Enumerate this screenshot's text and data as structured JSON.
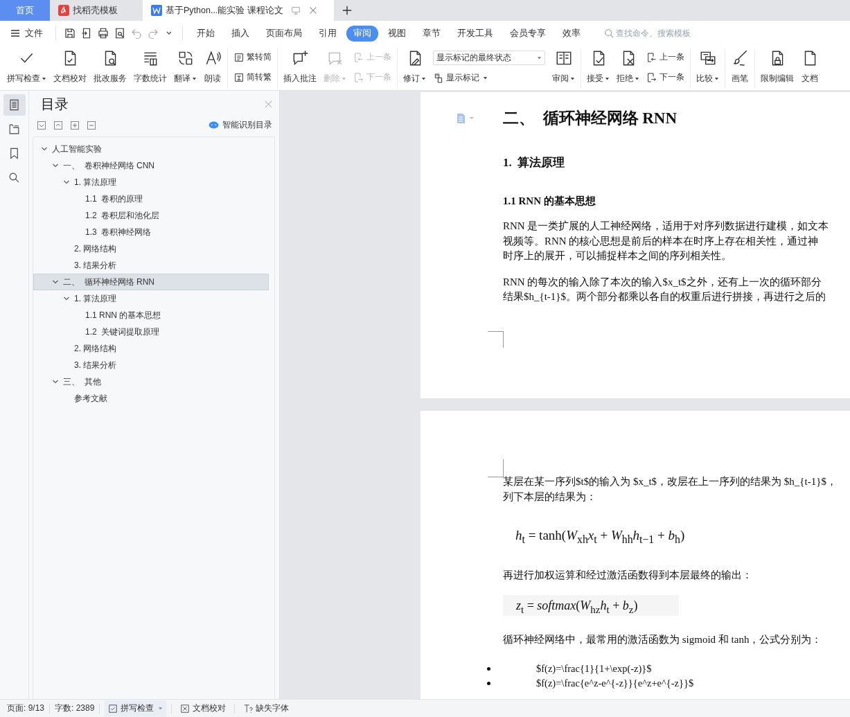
{
  "tabs": [
    {
      "kind": "home",
      "label": "首页",
      "selected": false
    },
    {
      "kind": "template",
      "label": "找稻壳模板",
      "selected": false
    },
    {
      "kind": "doc",
      "label": "基于Python...能实验 课程论文",
      "selected": true
    }
  ],
  "menu": {
    "file": "文件",
    "tabs": [
      {
        "label": "开始",
        "selected": false
      },
      {
        "label": "插入",
        "selected": false
      },
      {
        "label": "页面布局",
        "selected": false
      },
      {
        "label": "引用",
        "selected": false
      },
      {
        "label": "审阅",
        "selected": true
      },
      {
        "label": "视图",
        "selected": false
      },
      {
        "label": "章节",
        "selected": false
      },
      {
        "label": "开发工具",
        "selected": false
      },
      {
        "label": "会员专享",
        "selected": false
      },
      {
        "label": "效率",
        "selected": false
      }
    ],
    "search": {
      "placeholder": "查找命令、搜索模板"
    }
  },
  "ribbon": [
    {
      "items": [
        {
          "kind": "large",
          "label": "拼写检查",
          "dropdown": true,
          "disabled": false
        },
        {
          "kind": "large",
          "label": "文档校对",
          "dropdown": false,
          "disabled": false
        },
        {
          "kind": "large",
          "label": "批改服务",
          "dropdown": false,
          "disabled": false
        },
        {
          "kind": "large",
          "label": "字数统计",
          "dropdown": false,
          "disabled": false
        },
        {
          "kind": "large",
          "label": "翻译",
          "dropdown": true,
          "disabled": false
        },
        {
          "kind": "large",
          "label": "朗读",
          "dropdown": false,
          "disabled": false
        }
      ]
    },
    {
      "items": [
        {
          "kind": "stack",
          "items": [
            {
              "kind": "small",
              "label": "繁转简",
              "dropdown": false,
              "disabled": false
            },
            {
              "kind": "small",
              "label": "简转繁",
              "dropdown": false,
              "disabled": false
            }
          ]
        }
      ]
    },
    {
      "items": [
        {
          "kind": "large",
          "label": "插入批注",
          "dropdown": false,
          "disabled": false
        },
        {
          "kind": "large",
          "label": "删除",
          "dropdown": true,
          "disabled": true
        },
        {
          "kind": "stack",
          "items": [
            {
              "kind": "small",
              "label": "上一条",
              "dropdown": false,
              "disabled": true
            },
            {
              "kind": "small",
              "label": "下一条",
              "dropdown": false,
              "disabled": true
            }
          ]
        }
      ]
    },
    {
      "items": [
        {
          "kind": "large",
          "label": "修订",
          "dropdown": true,
          "disabled": false
        },
        {
          "kind": "stack",
          "items": [
            {
              "kind": "select",
              "value": "显示标记的最终状态"
            },
            {
              "kind": "small",
              "label": "显示标记",
              "dropdown": true,
              "disabled": false
            }
          ]
        },
        {
          "kind": "large",
          "label": "审阅",
          "dropdown": true,
          "disabled": false
        }
      ]
    },
    {
      "items": [
        {
          "kind": "large",
          "label": "接受",
          "dropdown": true,
          "disabled": false
        },
        {
          "kind": "large",
          "label": "拒绝",
          "dropdown": true,
          "disabled": false
        },
        {
          "kind": "stack",
          "items": [
            {
              "kind": "small",
              "label": "上一条",
              "dropdown": false,
              "disabled": false
            },
            {
              "kind": "small",
              "label": "下一条",
              "dropdown": false,
              "disabled": false
            }
          ]
        }
      ]
    },
    {
      "items": [
        {
          "kind": "large",
          "label": "比较",
          "dropdown": true,
          "disabled": false
        }
      ]
    },
    {
      "items": [
        {
          "kind": "large",
          "label": "画笔",
          "dropdown": false,
          "disabled": false
        }
      ]
    },
    {
      "items": [
        {
          "kind": "large",
          "label": "限制编辑",
          "dropdown": false,
          "disabled": false
        },
        {
          "kind": "large",
          "label": "文档",
          "dropdown": false,
          "disabled": false
        }
      ]
    }
  ],
  "sidebar": {
    "items": [
      {
        "selected": true
      },
      {
        "selected": false
      },
      {
        "selected": false
      },
      {
        "selected": false
      }
    ]
  },
  "toc": {
    "title": "目录",
    "smart_button": "智能识别目录",
    "tree": [
      {
        "label": "人工智能实验",
        "selected": false,
        "expanded": true,
        "children": [
          {
            "label": "一、  卷积神经网络 CNN",
            "selected": false,
            "expanded": true,
            "children": [
              {
                "label": "1. 算法原理",
                "selected": false,
                "expanded": true,
                "children": [
                  {
                    "label": "1.1  卷积的原理",
                    "selected": false
                  },
                  {
                    "label": "1.2  卷积层和池化层",
                    "selected": false
                  },
                  {
                    "label": "1.3  卷积神经网络",
                    "selected": false
                  }
                ]
              },
              {
                "label": "2. 网络结构",
                "selected": false
              },
              {
                "label": "3. 结果分析",
                "selected": false
              }
            ]
          },
          {
            "label": "二、  循环神经网络 RNN",
            "selected": true,
            "expanded": true,
            "children": [
              {
                "label": "1. 算法原理",
                "selected": false,
                "expanded": true,
                "children": [
                  {
                    "label": "1.1 RNN 的基本思想",
                    "selected": false
                  },
                  {
                    "label": "1.2  关键词提取原理",
                    "selected": false
                  }
                ]
              },
              {
                "label": "2. 网络结构",
                "selected": false
              },
              {
                "label": "3. 结果分析",
                "selected": false
              }
            ]
          },
          {
            "label": "三、  其他",
            "selected": false,
            "expanded": true,
            "children": [
              {
                "label": "参考文献",
                "selected": false
              }
            ]
          }
        ]
      }
    ]
  },
  "document": {
    "pages": [
      {
        "blocks": [
          {
            "kind": "h1",
            "text": "二、  循环神经网络 RNN"
          },
          {
            "kind": "h2",
            "text": "1.  算法原理"
          },
          {
            "kind": "h3",
            "text": "1.1 RNN 的基本思想"
          },
          {
            "kind": "para",
            "lines": [
              "RNN 是一类扩展的人工神经网络，适用于对序列数据进行建模，如文本",
              "视频等。RNN 的核心思想是前后的样本在时序上存在相关性，通过神",
              "时序上的展开，可以捕捉样本之间的序列相关性。"
            ]
          },
          {
            "kind": "para",
            "lines": [
              "RNN 的每次的输入除了本次的输入$x_t$之外，还有上一次的循环部分",
              "结果$h_{t-1}$。两个部分都乘以各自的权重后进行拼接，再进行之后的"
            ]
          }
        ]
      },
      {
        "blocks": [
          {
            "kind": "para",
            "lines": [
              "某层在某一序列$t$的输入为 $x_t$，改层在上一序列的结果为 $h_{t-1}$，",
              "列下本层的结果为："
            ]
          },
          {
            "kind": "formula",
            "text": "*h*$_{t}$ = tanh(*W*$_{xh}$*x*$_{t}$ + *W*$_{hh}$*h*$_{t−1}$ + *b*$_{h}$)"
          },
          {
            "kind": "para",
            "lines": [
              "再进行加权运算和经过激活函数得到本层最终的输出："
            ]
          },
          {
            "kind": "formula_box",
            "text": "*z*$_{t}$ = *softmax*(*W*$_{hz}$*h*$_{t}$ + *b*$_{z}$)"
          },
          {
            "kind": "para",
            "lines": [
              "循环神经网络中，最常用的激活函数为 sigmoid 和 tanh，公式分别为："
            ]
          },
          {
            "kind": "bullets",
            "items": [
              "$f(z)=\\frac{1}{1+\\exp(-z)}$",
              "$f(z)=\\frac{e^z-e^{-z}}{e^z+e^{-z}}$"
            ]
          }
        ]
      }
    ]
  },
  "status_bar": {
    "page": "页面: 9/13",
    "words": "字数: 2389",
    "spell_check": "拼写检查",
    "proofread": "文档校对",
    "missing_fonts": "缺失字体"
  }
}
